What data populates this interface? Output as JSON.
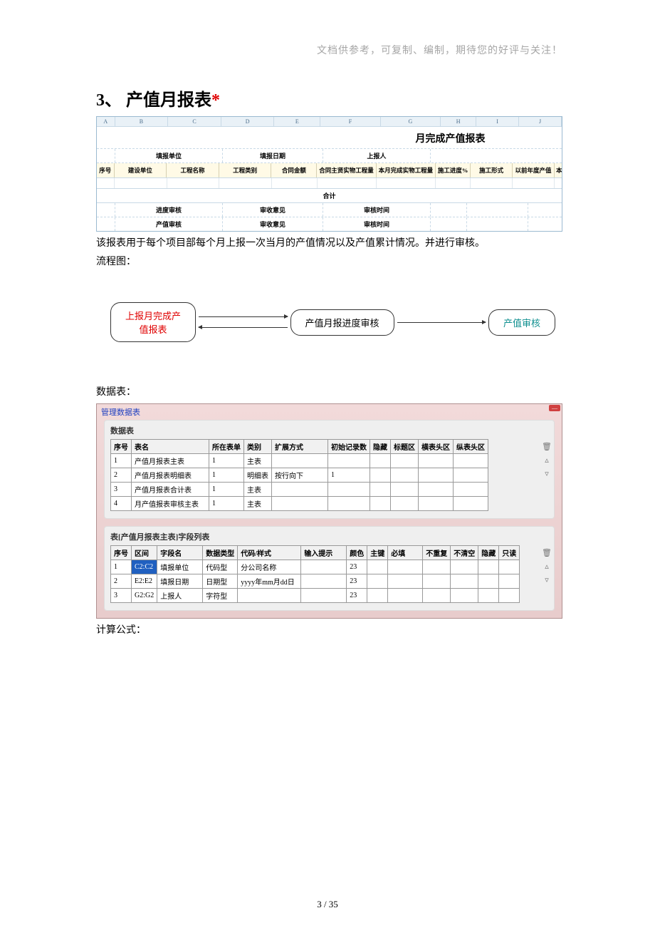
{
  "header_note": "文档供参考，可复制、编制，期待您的好评与关注！",
  "section_no": "3、",
  "section_title": "产值月报表",
  "asterisk": "*",
  "excel": {
    "cols": [
      "A",
      "B",
      "C",
      "D",
      "E",
      "F",
      "G",
      "H",
      "I",
      "J"
    ],
    "title": "月完成产值报表",
    "meta": [
      "填报单位",
      "填报日期",
      "上报人"
    ],
    "headers": [
      "序号",
      "建设单位",
      "工程名称",
      "工程类别",
      "合同金额",
      "合同主贤实物工程量",
      "本月完成实物工程量",
      "施工进度%",
      "施工形式",
      "以前年度产值",
      "本"
    ],
    "sum_label": "合计",
    "footer1": [
      "进度审核",
      "审收意见",
      "审核时间"
    ],
    "footer2": [
      "产值审核",
      "审收意见",
      "审核时间"
    ]
  },
  "body1": "该报表用于每个项目部每个月上报一次当月的产值情况以及产值累计情况。并进行审核。",
  "body2": "流程图：",
  "flow": {
    "box1_l1": "上报月完成产",
    "box1_l2": "值报表",
    "box2": "产值月报进度审核",
    "box3": "产值审核"
  },
  "body3": "数据表：",
  "panel_title": "管理数据表",
  "panel1_sub": "数据表",
  "table1": {
    "headers": [
      "序号",
      "表名",
      "所在表单",
      "类别",
      "扩展方式",
      "初始记录数",
      "隐藏",
      "标题区",
      "横表头区",
      "纵表头区"
    ],
    "rows": [
      [
        "1",
        "产值月报表主表",
        "1",
        "主表",
        "",
        "",
        "",
        "",
        "",
        ""
      ],
      [
        "2",
        "产值月报表明细表",
        "1",
        "明细表",
        "按行向下",
        "1",
        "",
        "",
        "",
        ""
      ],
      [
        "3",
        "产值月报表合计表",
        "1",
        "主表",
        "",
        "",
        "",
        "",
        "",
        ""
      ],
      [
        "4",
        "月产值报表审核主表",
        "1",
        "主表",
        "",
        "",
        "",
        "",
        "",
        ""
      ]
    ]
  },
  "panel2_sub": "表[产值月报表主表]字段列表",
  "table2": {
    "headers": [
      "序号",
      "区间",
      "字段名",
      "数据类型",
      "代码/样式",
      "输入提示",
      "颜色",
      "主键",
      "必填",
      "不重复",
      "不清空",
      "隐藏",
      "只读"
    ],
    "rows": [
      [
        "1",
        "C2:C2",
        "填报单位",
        "代码型",
        "分公司名称",
        "",
        "23",
        "",
        "",
        "",
        "",
        "",
        ""
      ],
      [
        "2",
        "E2:E2",
        "填报日期",
        "日期型",
        "yyyy年mm月dd日",
        "",
        "23",
        "",
        "",
        "",
        "",
        "",
        ""
      ],
      [
        "3",
        "G2:G2",
        "上报人",
        "字符型",
        "",
        "",
        "23",
        "",
        "",
        "",
        "",
        "",
        ""
      ]
    ]
  },
  "body4": "计算公式：",
  "page_num": "3  /  35",
  "icon_trash": "🗑",
  "icon_up": "▵",
  "icon_down": "▿"
}
